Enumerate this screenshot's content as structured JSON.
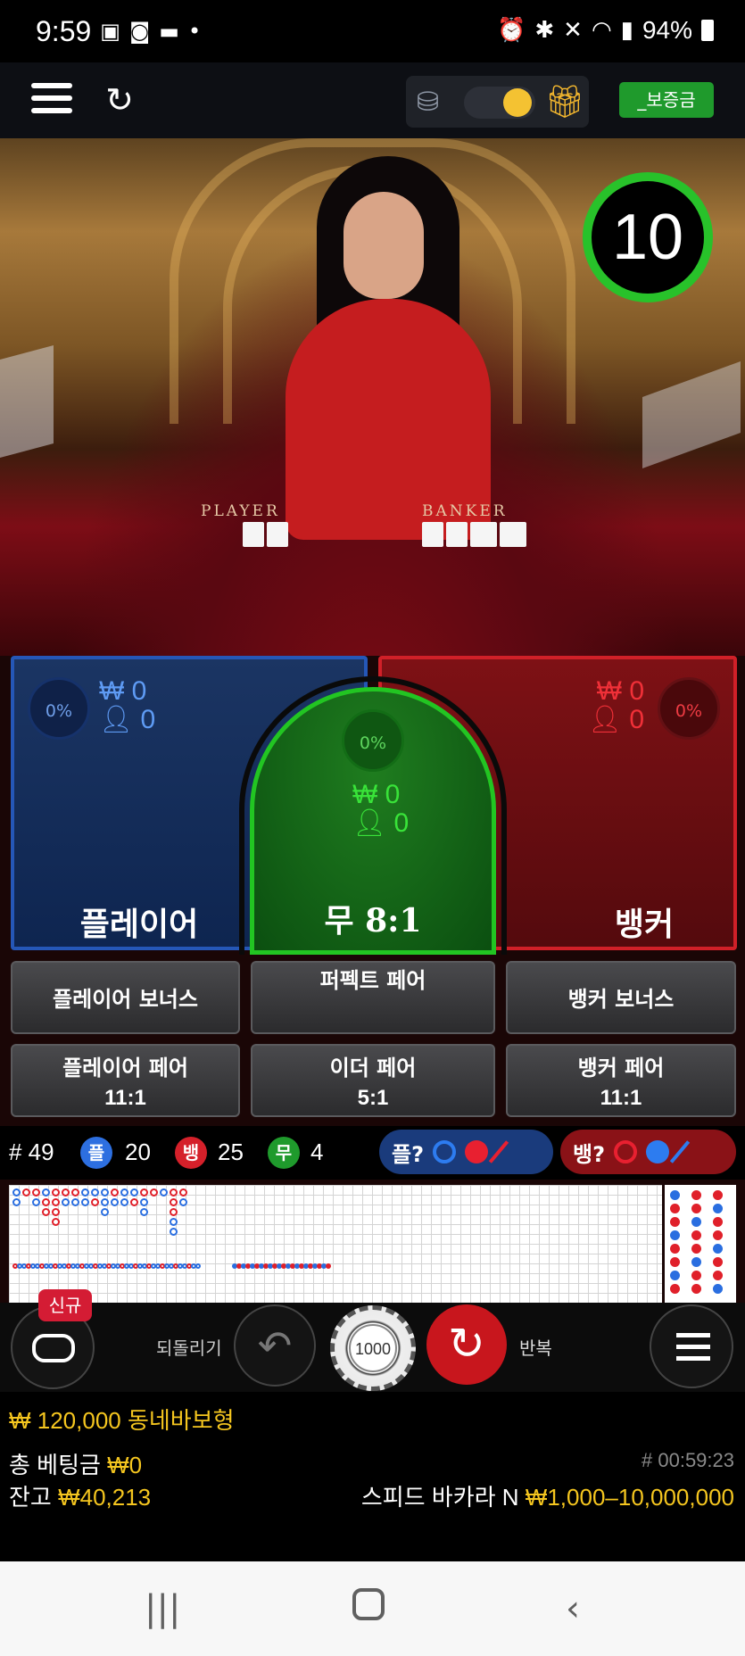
{
  "status_bar": {
    "time": "9:59",
    "battery": "94%",
    "left_icons": [
      "image-icon",
      "ok-icon",
      "chat-icon",
      "dot-icon"
    ],
    "right_icons": [
      "alarm-icon",
      "bluetooth-icon",
      "mute-icon",
      "wifi-icon",
      "signal-icon",
      "battery-icon"
    ]
  },
  "top_bar": {
    "deposit_label": "_보증금"
  },
  "timer": {
    "value": "10"
  },
  "table": {
    "player_label": "PLAYER",
    "banker_label": "BANKER"
  },
  "bets": {
    "player": {
      "label": "플레이어",
      "percent": "0%",
      "amount": "0",
      "players": "0"
    },
    "tie": {
      "label": "무 8:1",
      "percent": "0%",
      "amount": "0",
      "players": "0"
    },
    "banker": {
      "label": "뱅커",
      "percent": "0%",
      "amount": "0",
      "players": "0"
    },
    "currency": "₩"
  },
  "side_bets": [
    {
      "label": "플레이어 보너스",
      "odds": ""
    },
    {
      "label": "퍼펙트 페어",
      "odds": ""
    },
    {
      "label": "뱅커 보너스",
      "odds": ""
    },
    {
      "label": "플레이어 페어",
      "odds": "11:1"
    },
    {
      "label": "이더 페어",
      "odds": "5:1"
    },
    {
      "label": "뱅커 페어",
      "odds": "11:1"
    }
  ],
  "stats": {
    "round": "# 49",
    "player_badge": "플",
    "player_count": "20",
    "banker_badge": "뱅",
    "banker_count": "25",
    "tie_badge": "무",
    "tie_count": "4",
    "player_ask": "플?",
    "banker_ask": "뱅?"
  },
  "controls": {
    "new_badge": "신규",
    "undo_label": "되돌리기",
    "chip_value": "1000",
    "repeat_label": "반복"
  },
  "info": {
    "jackpot": "₩ 120,000 동네바보형",
    "total_bet_label": "총 베팅금",
    "total_bet_value": "₩0",
    "balance_label": "잔고",
    "balance_value": "₩40,213",
    "round_id": "# 00:59:23",
    "game_name": "스피드 바카라 N",
    "limits": "₩1,000–10,000,000"
  },
  "colors": {
    "player_blue": "#2557b7",
    "banker_red": "#d02028",
    "tie_green": "#22c522",
    "gold": "#f5c61f",
    "timer_green": "#28c22a"
  }
}
